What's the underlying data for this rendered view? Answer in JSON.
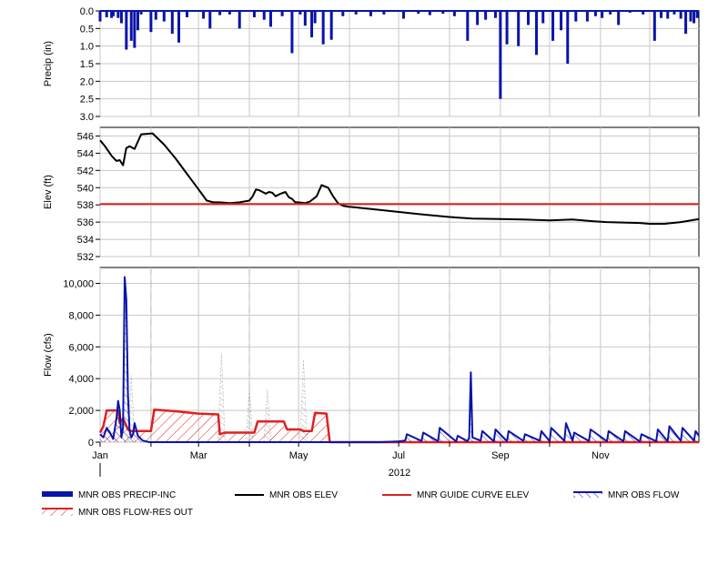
{
  "chart_data": {
    "type": "multi-panel timeseries",
    "x_axis": {
      "month_ticks": [
        "Jan",
        "Mar",
        "May",
        "Jul",
        "Sep",
        "Nov"
      ],
      "year_label": "2012",
      "domain": [
        "2012-01-01",
        "2012-12-31"
      ]
    },
    "panels": [
      {
        "id": "precip",
        "ylabel": "Precip (in)",
        "ylim": [
          3.0,
          0.0
        ],
        "inverted": true,
        "y_ticks": [
          "0.0",
          "0.5",
          "1.0",
          "1.5",
          "2.0",
          "2.5",
          "3.0"
        ],
        "series": [
          {
            "name": "MNR OBS PRECIP-INC",
            "type": "bar",
            "color": "#0a14a8",
            "x": [
              "2012-01-01",
              "2012-01-05",
              "2012-01-08",
              "2012-01-09",
              "2012-01-12",
              "2012-01-14",
              "2012-01-17",
              "2012-01-20",
              "2012-01-22",
              "2012-01-24",
              "2012-01-26",
              "2012-02-01",
              "2012-02-04",
              "2012-02-09",
              "2012-02-14",
              "2012-02-18",
              "2012-02-23",
              "2012-03-04",
              "2012-03-08",
              "2012-03-14",
              "2012-03-20",
              "2012-03-26",
              "2012-04-04",
              "2012-04-10",
              "2012-04-14",
              "2012-04-21",
              "2012-04-27",
              "2012-05-02",
              "2012-05-05",
              "2012-05-09",
              "2012-05-11",
              "2012-05-16",
              "2012-05-21",
              "2012-05-28",
              "2012-06-05",
              "2012-06-14",
              "2012-06-22",
              "2012-07-04",
              "2012-07-13",
              "2012-07-20",
              "2012-07-28",
              "2012-08-04",
              "2012-08-12",
              "2012-08-18",
              "2012-08-23",
              "2012-08-29",
              "2012-09-01",
              "2012-09-05",
              "2012-09-12",
              "2012-09-18",
              "2012-09-23",
              "2012-09-27",
              "2012-10-03",
              "2012-10-08",
              "2012-10-12",
              "2012-10-17",
              "2012-10-24",
              "2012-10-29",
              "2012-11-02",
              "2012-11-07",
              "2012-11-12",
              "2012-11-19",
              "2012-11-27",
              "2012-12-04",
              "2012-12-08",
              "2012-12-12",
              "2012-12-16",
              "2012-12-20",
              "2012-12-23",
              "2012-12-26",
              "2012-12-28",
              "2012-12-30"
            ],
            "values": [
              0.3,
              0.18,
              0.2,
              0.15,
              0.2,
              0.35,
              1.1,
              0.85,
              1.05,
              0.55,
              0.1,
              0.6,
              0.25,
              0.3,
              0.65,
              0.9,
              0.18,
              0.22,
              0.5,
              0.12,
              0.1,
              0.5,
              0.18,
              0.25,
              0.45,
              0.15,
              1.2,
              0.1,
              0.42,
              0.75,
              0.35,
              0.95,
              0.82,
              0.15,
              0.1,
              0.15,
              0.1,
              0.22,
              0.08,
              0.12,
              0.08,
              0.15,
              0.85,
              0.4,
              0.25,
              0.2,
              2.5,
              0.95,
              1.0,
              0.4,
              1.25,
              0.35,
              0.85,
              0.55,
              1.5,
              0.3,
              0.3,
              0.15,
              0.2,
              0.1,
              0.4,
              0.05,
              0.1,
              0.85,
              0.2,
              0.22,
              0.1,
              0.22,
              0.65,
              0.3,
              0.35,
              0.2
            ]
          }
        ]
      },
      {
        "id": "elev",
        "ylabel": "Elev (ft)",
        "ylim": [
          532,
          547
        ],
        "y_ticks": [
          "532",
          "534",
          "536",
          "538",
          "540",
          "542",
          "544",
          "546"
        ],
        "series": [
          {
            "name": "MNR OBS ELEV",
            "type": "line",
            "color": "#000000",
            "x": [
              "2012-01-01",
              "2012-01-04",
              "2012-01-08",
              "2012-01-11",
              "2012-01-13",
              "2012-01-15",
              "2012-01-17",
              "2012-01-19",
              "2012-01-22",
              "2012-01-26",
              "2012-02-02",
              "2012-02-09",
              "2012-02-16",
              "2012-02-23",
              "2012-03-01",
              "2012-03-06",
              "2012-03-10",
              "2012-03-14",
              "2012-03-20",
              "2012-03-26",
              "2012-04-01",
              "2012-04-03",
              "2012-04-05",
              "2012-04-07",
              "2012-04-09",
              "2012-04-11",
              "2012-04-13",
              "2012-04-15",
              "2012-04-17",
              "2012-04-20",
              "2012-04-23",
              "2012-04-25",
              "2012-04-27",
              "2012-04-29",
              "2012-05-01",
              "2012-05-05",
              "2012-05-08",
              "2012-05-12",
              "2012-05-15",
              "2012-05-19",
              "2012-05-22",
              "2012-05-25",
              "2012-05-28",
              "2012-05-31",
              "2012-06-05",
              "2012-06-15",
              "2012-06-30",
              "2012-07-15",
              "2012-08-01",
              "2012-08-15",
              "2012-09-01",
              "2012-09-15",
              "2012-10-01",
              "2012-10-15",
              "2012-10-28",
              "2012-11-05",
              "2012-11-15",
              "2012-11-25",
              "2012-12-01",
              "2012-12-10",
              "2012-12-20",
              "2012-12-31"
            ],
            "values": [
              545.5,
              544.8,
              543.7,
              543.1,
              543.2,
              542.6,
              544.6,
              544.8,
              544.5,
              546.2,
              546.3,
              545.0,
              543.4,
              541.6,
              539.8,
              538.5,
              538.3,
              538.3,
              538.2,
              538.3,
              538.5,
              539.0,
              539.8,
              539.7,
              539.5,
              539.3,
              539.5,
              539.4,
              539.0,
              539.3,
              539.5,
              538.9,
              538.7,
              538.3,
              538.3,
              538.2,
              538.4,
              539.0,
              540.3,
              540.0,
              539.0,
              538.2,
              537.9,
              537.8,
              537.7,
              537.5,
              537.2,
              536.9,
              536.6,
              536.4,
              536.35,
              536.3,
              536.2,
              536.3,
              536.1,
              536.0,
              535.95,
              535.9,
              535.8,
              535.8,
              536.0,
              536.35
            ]
          },
          {
            "name": "MNR GUIDE CURVE ELEV",
            "type": "line",
            "color": "#e02020",
            "x": [
              "2012-01-01",
              "2012-12-31"
            ],
            "values": [
              538.1,
              538.1
            ]
          }
        ]
      },
      {
        "id": "flow",
        "ylabel": "Flow (cfs)",
        "ylim": [
          0,
          11000
        ],
        "y_ticks": [
          "0",
          "2,000",
          "4,000",
          "6,000",
          "8,000",
          "10,000"
        ],
        "series": [
          {
            "name": "MNR OBS FLOW",
            "type": "line",
            "color": "#0a14a8",
            "x": [
              "2012-01-01",
              "2012-01-03",
              "2012-01-05",
              "2012-01-07",
              "2012-01-09",
              "2012-01-11",
              "2012-01-12",
              "2012-01-13",
              "2012-01-14",
              "2012-01-15",
              "2012-01-16",
              "2012-01-17",
              "2012-01-18",
              "2012-01-19",
              "2012-01-20",
              "2012-01-21",
              "2012-01-22",
              "2012-01-24",
              "2012-01-27",
              "2012-01-31",
              "2012-02-05",
              "2012-06-20",
              "2012-07-01",
              "2012-07-05",
              "2012-07-06",
              "2012-07-15",
              "2012-07-16",
              "2012-07-25",
              "2012-07-26",
              "2012-08-05",
              "2012-08-06",
              "2012-08-12",
              "2012-08-13",
              "2012-08-14",
              "2012-08-15",
              "2012-08-20",
              "2012-08-21",
              "2012-08-28",
              "2012-08-29",
              "2012-09-05",
              "2012-09-06",
              "2012-09-15",
              "2012-09-16",
              "2012-09-25",
              "2012-09-26",
              "2012-10-01",
              "2012-10-02",
              "2012-10-10",
              "2012-10-11",
              "2012-10-15",
              "2012-10-16",
              "2012-10-25",
              "2012-10-26",
              "2012-11-05",
              "2012-11-06",
              "2012-11-15",
              "2012-11-16",
              "2012-11-25",
              "2012-11-26",
              "2012-12-05",
              "2012-12-06",
              "2012-12-12",
              "2012-12-13",
              "2012-12-20",
              "2012-12-21",
              "2012-12-28",
              "2012-12-29",
              "2012-12-31"
            ],
            "values": [
              500,
              300,
              900,
              600,
              200,
              1500,
              2600,
              2000,
              300,
              900,
              10400,
              9000,
              3000,
              700,
              300,
              500,
              1200,
              400,
              100,
              0,
              0,
              0,
              50,
              100,
              500,
              80,
              600,
              60,
              900,
              50,
              400,
              60,
              300,
              4400,
              300,
              100,
              700,
              50,
              800,
              60,
              700,
              80,
              500,
              100,
              700,
              60,
              900,
              80,
              1200,
              100,
              600,
              70,
              800,
              60,
              700,
              50,
              700,
              40,
              500,
              60,
              800,
              50,
              1000,
              80,
              900,
              100,
              700,
              400
            ]
          },
          {
            "name": "MNR OBS FLOW-RES OUT",
            "type": "area",
            "color": "#e02020",
            "x": [
              "2012-01-01",
              "2012-01-03",
              "2012-01-05",
              "2012-01-12",
              "2012-01-13",
              "2012-01-15",
              "2012-01-18",
              "2012-01-20",
              "2012-02-01",
              "2012-02-03",
              "2012-02-16",
              "2012-03-01",
              "2012-03-13",
              "2012-03-14",
              "2012-03-17",
              "2012-04-04",
              "2012-04-06",
              "2012-04-10",
              "2012-04-14",
              "2012-04-22",
              "2012-04-24",
              "2012-05-02",
              "2012-05-04",
              "2012-05-09",
              "2012-05-11",
              "2012-05-18",
              "2012-05-20",
              "2012-12-31"
            ],
            "values": [
              600,
              1000,
              2000,
              2000,
              1200,
              1500,
              800,
              700,
              700,
              2050,
              1950,
              1800,
              1750,
              500,
              600,
              600,
              1300,
              1300,
              1300,
              1300,
              800,
              800,
              700,
              700,
              1850,
              1800,
              0,
              0
            ]
          }
        ]
      }
    ],
    "legend": {
      "placement": "bottom",
      "entries": [
        {
          "label": "MNR OBS PRECIP-INC",
          "color": "#0a14a8"
        },
        {
          "label": "MNR OBS ELEV",
          "color": "#000000"
        },
        {
          "label": "MNR GUIDE CURVE ELEV",
          "color": "#e02020"
        },
        {
          "label": "MNR OBS FLOW",
          "color": "#0a14a8"
        },
        {
          "label": "MNR OBS FLOW-RES OUT",
          "color": "#e02020"
        }
      ]
    },
    "grid": true
  }
}
